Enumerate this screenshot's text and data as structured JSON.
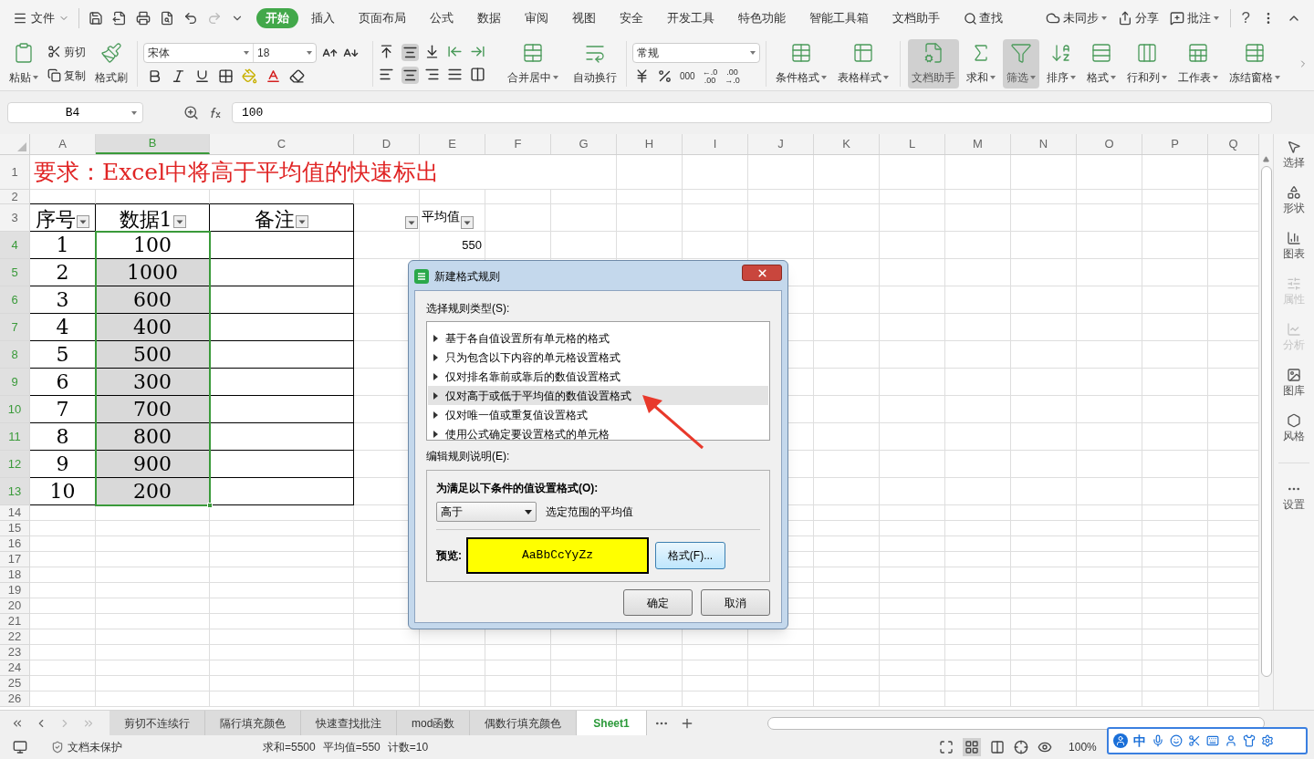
{
  "menu": {
    "file": "文件",
    "tabs": [
      {
        "label": "开始",
        "selected": true
      },
      {
        "label": "插入",
        "selected": false
      },
      {
        "label": "页面布局",
        "selected": false
      },
      {
        "label": "公式",
        "selected": false
      },
      {
        "label": "数据",
        "selected": false
      },
      {
        "label": "审阅",
        "selected": false
      },
      {
        "label": "视图",
        "selected": false
      },
      {
        "label": "安全",
        "selected": false
      },
      {
        "label": "开发工具",
        "selected": false
      },
      {
        "label": "特色功能",
        "selected": false
      },
      {
        "label": "智能工具箱",
        "selected": false
      },
      {
        "label": "文档助手",
        "selected": false
      }
    ],
    "search": "查找",
    "sync": "未同步",
    "share": "分享",
    "comment": "批注",
    "help": "?"
  },
  "ribbon": {
    "clipboard": {
      "paste": "粘贴",
      "cut": "剪切",
      "copy": "复制",
      "painter": "格式刷"
    },
    "font": {
      "name": "宋体",
      "size": "18"
    },
    "align": {
      "merge": "合并居中",
      "wrap": "自动换行"
    },
    "number": {
      "format": "常规",
      "thousands": "000",
      "increase": [
        "←.0",
        ".00"
      ],
      "decrease": [
        ".00",
        "→.0"
      ]
    },
    "tools": [
      {
        "label": "条件格式",
        "selected": false,
        "dropdown": true
      },
      {
        "label": "表格样式",
        "selected": false,
        "dropdown": true
      },
      {
        "label": "文档助手",
        "selected": true,
        "dropdown": false
      },
      {
        "label": "求和",
        "selected": false,
        "dropdown": true
      },
      {
        "label": "筛选",
        "selected": true,
        "dropdown": true
      },
      {
        "label": "排序",
        "selected": false,
        "dropdown": true
      },
      {
        "label": "格式",
        "selected": false,
        "dropdown": true
      },
      {
        "label": "行和列",
        "selected": false,
        "dropdown": true
      },
      {
        "label": "工作表",
        "selected": false,
        "dropdown": true
      },
      {
        "label": "冻结窗格",
        "selected": false,
        "dropdown": true
      }
    ]
  },
  "formula_bar": {
    "name_box": "B4",
    "formula": "100"
  },
  "sheet": {
    "columns": [
      {
        "label": "A",
        "selected": false
      },
      {
        "label": "B",
        "selected": true
      },
      {
        "label": "C",
        "selected": false
      },
      {
        "label": "D",
        "selected": false
      },
      {
        "label": "E",
        "selected": false
      },
      {
        "label": "F",
        "selected": false
      },
      {
        "label": "G",
        "selected": false
      },
      {
        "label": "H",
        "selected": false
      },
      {
        "label": "I",
        "selected": false
      },
      {
        "label": "J",
        "selected": false
      },
      {
        "label": "K",
        "selected": false
      },
      {
        "label": "L",
        "selected": false
      },
      {
        "label": "M",
        "selected": false
      },
      {
        "label": "N",
        "selected": false
      },
      {
        "label": "O",
        "selected": false
      },
      {
        "label": "P",
        "selected": false
      },
      {
        "label": "Q",
        "selected": false
      }
    ],
    "rows": [
      {
        "number": "1",
        "selected": false
      },
      {
        "number": "2",
        "selected": false
      },
      {
        "number": "3",
        "selected": false
      },
      {
        "number": "4",
        "selected": true
      },
      {
        "number": "5",
        "selected": true
      },
      {
        "number": "6",
        "selected": true
      },
      {
        "number": "7",
        "selected": true
      },
      {
        "number": "8",
        "selected": true
      },
      {
        "number": "9",
        "selected": true
      },
      {
        "number": "10",
        "selected": true
      },
      {
        "number": "11",
        "selected": true
      },
      {
        "number": "12",
        "selected": true
      },
      {
        "number": "13",
        "selected": true
      },
      {
        "number": "14",
        "selected": false
      },
      {
        "number": "15",
        "selected": false
      },
      {
        "number": "16",
        "selected": false
      },
      {
        "number": "17",
        "selected": false
      },
      {
        "number": "18",
        "selected": false
      },
      {
        "number": "19",
        "selected": false
      },
      {
        "number": "20",
        "selected": false
      },
      {
        "number": "21",
        "selected": false
      },
      {
        "number": "22",
        "selected": false
      },
      {
        "number": "23",
        "selected": false
      },
      {
        "number": "24",
        "selected": false
      },
      {
        "number": "25",
        "selected": false
      },
      {
        "number": "26",
        "selected": false
      }
    ],
    "title": "要求：Excel中将高于平均值的快速标出",
    "headers": [
      {
        "text": "序号",
        "kind": "table",
        "filter": true
      },
      {
        "text": "数据1",
        "kind": "table",
        "filter": true
      },
      {
        "text": "备注",
        "kind": "table",
        "filter": true
      },
      {
        "kind": "plain",
        "filter": true
      },
      {
        "text": "平均值",
        "kind": "label",
        "filter": true
      }
    ],
    "average_value": "550",
    "records": [
      {
        "index": "1",
        "value": "100",
        "shaded": false
      },
      {
        "index": "2",
        "value": "1000",
        "shaded": true
      },
      {
        "index": "3",
        "value": "600",
        "shaded": true
      },
      {
        "index": "4",
        "value": "400",
        "shaded": true
      },
      {
        "index": "5",
        "value": "500",
        "shaded": true
      },
      {
        "index": "6",
        "value": "300",
        "shaded": true
      },
      {
        "index": "7",
        "value": "700",
        "shaded": true
      },
      {
        "index": "8",
        "value": "800",
        "shaded": true
      },
      {
        "index": "9",
        "value": "900",
        "shaded": true
      },
      {
        "index": "10",
        "value": "200",
        "shaded": true
      }
    ]
  },
  "dialog": {
    "title": "新建格式规则",
    "section1": "选择规则类型(S):",
    "rule_types": [
      {
        "label": "基于各自值设置所有单元格的格式",
        "selected": false
      },
      {
        "label": "只为包含以下内容的单元格设置格式",
        "selected": false
      },
      {
        "label": "仅对排名靠前或靠后的数值设置格式",
        "selected": false
      },
      {
        "label": "仅对高于或低于平均值的数值设置格式",
        "selected": true
      },
      {
        "label": "仅对唯一值或重复值设置格式",
        "selected": false
      },
      {
        "label": "使用公式确定要设置格式的单元格",
        "selected": false
      }
    ],
    "section2": "编辑规则说明(E):",
    "condition_label": "为满足以下条件的值设置格式(O):",
    "comparison": "高于",
    "comparison_suffix": "选定范围的平均值",
    "preview_label": "预览:",
    "preview_text": "AaBbCcYyZz",
    "format_button": "格式(F)...",
    "ok": "确定",
    "cancel": "取消"
  },
  "sheet_tabs": [
    {
      "label": "剪切不连续行",
      "selected": false
    },
    {
      "label": "隔行填充颜色",
      "selected": false
    },
    {
      "label": "快速查找批注",
      "selected": false
    },
    {
      "label": "mod函数",
      "selected": false
    },
    {
      "label": "偶数行填充颜色",
      "selected": false
    },
    {
      "label": "Sheet1",
      "selected": true
    }
  ],
  "side_panel": [
    {
      "label": "选择",
      "disabled": false
    },
    {
      "label": "形状",
      "disabled": false
    },
    {
      "label": "图表",
      "disabled": false
    },
    {
      "label": "属性",
      "disabled": true
    },
    {
      "label": "分析",
      "disabled": true
    },
    {
      "label": "图库",
      "disabled": false
    },
    {
      "label": "风格",
      "disabled": false
    },
    {
      "label": "设置",
      "disabled": false
    }
  ],
  "status_bar": {
    "protection": "文档未保护",
    "sum": "求和=5500",
    "average": "平均值=550",
    "count": "计数=10",
    "zoom": "100%"
  },
  "ime": {
    "mode": "中"
  }
}
